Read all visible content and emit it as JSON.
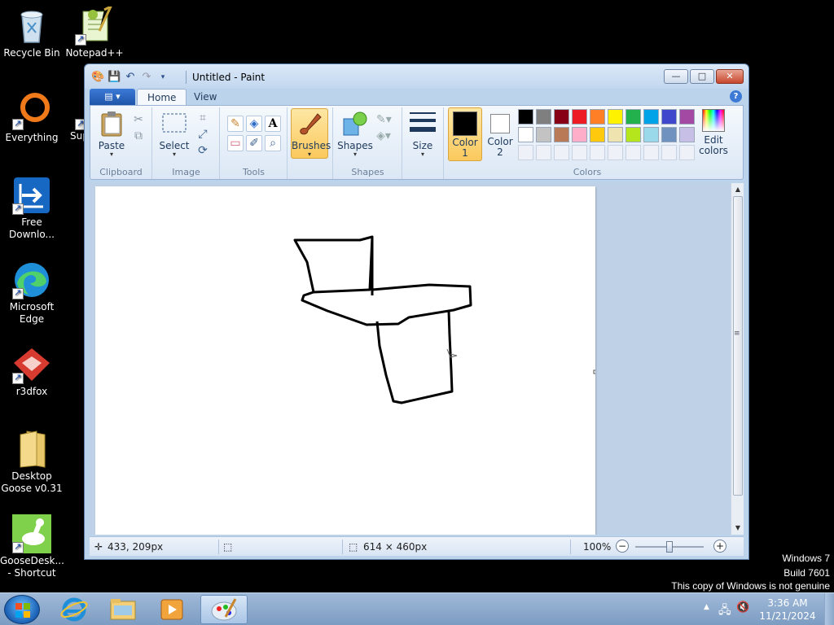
{
  "desktop": {
    "icons": [
      {
        "label": "Recycle Bin",
        "icon": "recycle-bin-icon"
      },
      {
        "label": "Notepad++",
        "icon": "notepad-plus-plus-icon"
      },
      {
        "label": "Everything",
        "icon": "everything-icon"
      },
      {
        "label": "Sup",
        "icon": "partial-icon"
      },
      {
        "label": "Free Downlo...",
        "icon": "free-download-manager-icon"
      },
      {
        "label": "Microsoft Edge",
        "icon": "edge-icon"
      },
      {
        "label": "r3dfox",
        "icon": "r3dfox-icon"
      },
      {
        "label": "Desktop Goose v0.31",
        "icon": "folder-icon"
      },
      {
        "label": "GooseDesk... - Shortcut",
        "icon": "goose-icon"
      }
    ]
  },
  "window": {
    "title": "Untitled - Paint",
    "controls": {
      "minimize": "—",
      "maximize": "□",
      "close": "✕"
    }
  },
  "ribbon": {
    "app_menu": "▤ ▾",
    "tabs": [
      {
        "label": "Home",
        "active": true
      },
      {
        "label": "View",
        "active": false
      }
    ],
    "help": "?",
    "groups": {
      "clipboard": {
        "label": "Clipboard",
        "paste": "Paste"
      },
      "image": {
        "label": "Image",
        "select": "Select"
      },
      "tools": {
        "label": "Tools"
      },
      "brushes": {
        "label": "Brushes"
      },
      "shapes": {
        "label": "Shapes",
        "shapes_btn": "Shapes"
      },
      "size": {
        "label": "Size"
      },
      "colors": {
        "label": "Colors",
        "color1": "Color\n1",
        "color2": "Color\n2",
        "edit": "Edit colors",
        "color1_value": "#000000",
        "color2_value": "#ffffff",
        "palette_row1": [
          "#000000",
          "#7f7f7f",
          "#880015",
          "#ed1c24",
          "#ff7f27",
          "#fff200",
          "#22b14c",
          "#00a2e8",
          "#3f48cc",
          "#a349a4"
        ],
        "palette_row2": [
          "#ffffff",
          "#c3c3c3",
          "#b97a57",
          "#ffaec9",
          "#ffc90e",
          "#efe4b0",
          "#b5e61d",
          "#99d9ea",
          "#7092be",
          "#c8bfe7"
        ]
      }
    }
  },
  "statusbar": {
    "cursor_pos": "433, 209px",
    "selection": "",
    "canvas_size": "614 × 460px",
    "zoom": "100%"
  },
  "watermark": {
    "line1": "Windows 7",
    "line2": "Build 7601",
    "line3": "This copy of Windows is not genuine"
  },
  "taskbar": {
    "time": "3:36 AM",
    "date": "11/21/2024",
    "pinned": [
      "internet-explorer-icon",
      "explorer-icon",
      "media-player-icon",
      "paint-icon"
    ]
  }
}
